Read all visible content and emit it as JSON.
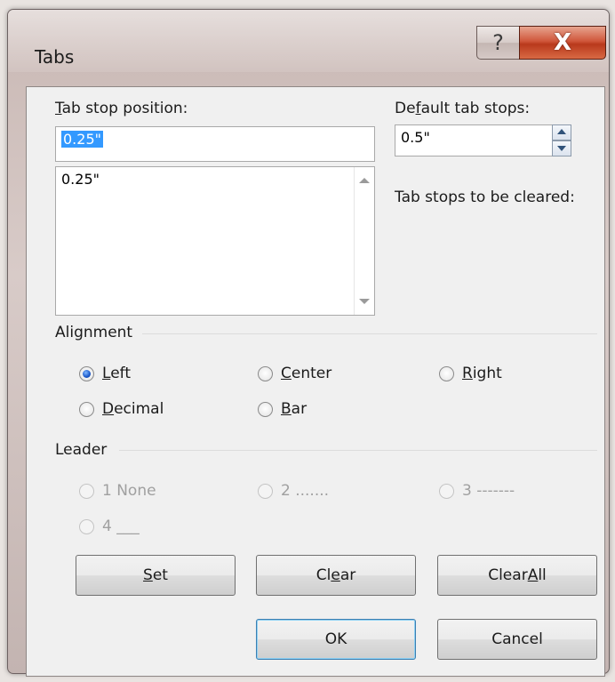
{
  "window": {
    "title": "Tabs",
    "help_glyph": "?",
    "close_glyph": "X"
  },
  "tab_stop_position": {
    "label_pre": "",
    "label_key": "T",
    "label_post": "ab stop position:",
    "value": "0.25\""
  },
  "tab_stop_list": {
    "items": [
      "0.25\""
    ]
  },
  "default_tab_stops": {
    "label_pre": "De",
    "label_key": "f",
    "label_post": "ault tab stops:",
    "value": "0.5\""
  },
  "tab_stops_cleared_label": "Tab stops to be cleared:",
  "alignment": {
    "title": "Alignment",
    "options": [
      {
        "pre": "",
        "key": "L",
        "post": "eft",
        "checked": true
      },
      {
        "pre": "",
        "key": "C",
        "post": "enter",
        "checked": false
      },
      {
        "pre": "",
        "key": "R",
        "post": "ight",
        "checked": false
      },
      {
        "pre": "",
        "key": "D",
        "post": "ecimal",
        "checked": false
      },
      {
        "pre": "",
        "key": "B",
        "post": "ar",
        "checked": false
      }
    ]
  },
  "leader": {
    "title": "Leader",
    "options": [
      "1 None",
      "2 .......",
      "3 -------",
      "4 ___"
    ]
  },
  "buttons": {
    "set": {
      "pre": "",
      "key": "S",
      "post": "et"
    },
    "clear": {
      "pre": "Cl",
      "key": "e",
      "post": "ar"
    },
    "clear_all": {
      "pre": "Clear ",
      "key": "A",
      "post": "ll"
    },
    "ok": "OK",
    "cancel": "Cancel"
  }
}
